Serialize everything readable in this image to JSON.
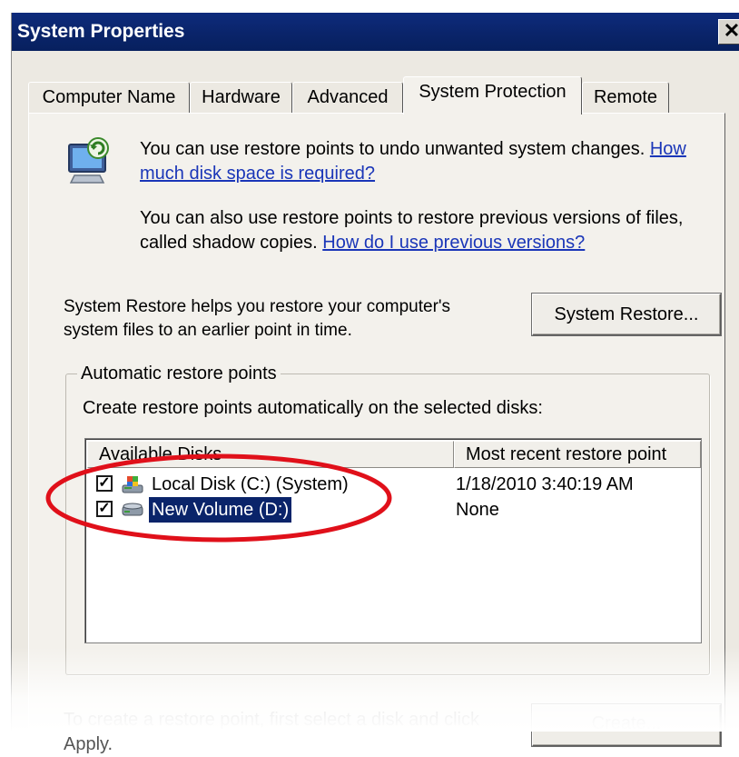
{
  "window": {
    "title": "System Properties",
    "close_glyph": "✕"
  },
  "tabs": [
    {
      "label": "Computer Name",
      "active": false
    },
    {
      "label": "Hardware",
      "active": false
    },
    {
      "label": "Advanced",
      "active": false
    },
    {
      "label": "System Protection",
      "active": true
    },
    {
      "label": "Remote",
      "active": false
    }
  ],
  "intro": {
    "icon": "system-restore-icon",
    "line1_text": "You can use restore points to undo unwanted system changes.",
    "line1_link": "How much disk space is required?",
    "line2_text": "You can also use restore points to restore previous versions of files, called shadow copies.",
    "line2_link": "How do I use previous versions?"
  },
  "system_restore": {
    "description": "System Restore helps you restore your computer's system files to an earlier point in time.",
    "button_label": "System Restore..."
  },
  "automatic": {
    "group_label": "Automatic restore points",
    "instruction": "Create restore points automatically on the selected disks:",
    "columns": [
      "Available Disks",
      "Most recent restore point"
    ],
    "disks": [
      {
        "checked": true,
        "icon": "system-drive-icon",
        "name": "Local Disk (C:) (System)",
        "restore_point": "1/18/2010 3:40:19 AM",
        "selected": false
      },
      {
        "checked": true,
        "icon": "hard-drive-icon",
        "name": "New Volume (D:)",
        "restore_point": "None",
        "selected": true
      }
    ]
  },
  "footer": {
    "text": "To create a restore point, first select a disk and click Apply.",
    "button_label": "Create..."
  },
  "annotation": {
    "color": "#e0101a"
  }
}
